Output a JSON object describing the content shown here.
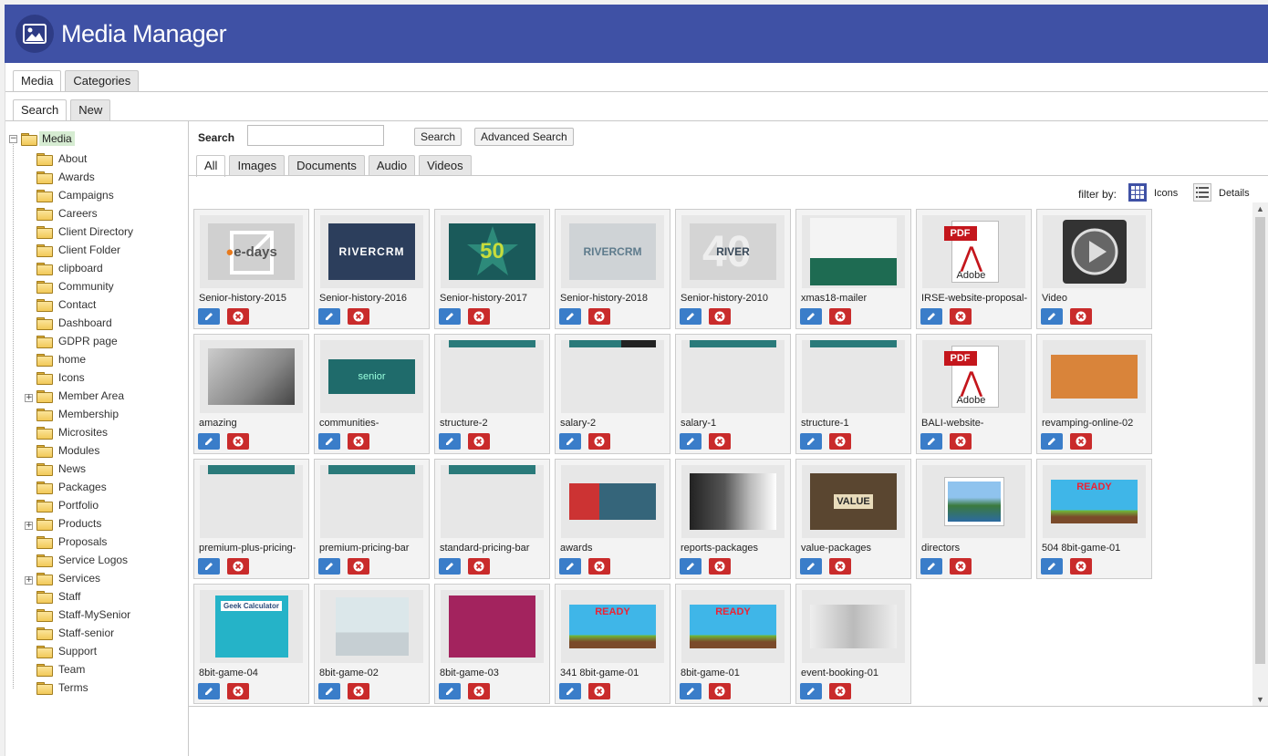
{
  "header": {
    "title": "Media Manager",
    "icon": "image-icon"
  },
  "top_tabs": [
    {
      "label": "Media",
      "active": true
    },
    {
      "label": "Categories",
      "active": false
    }
  ],
  "sub_tabs": [
    {
      "label": "Search",
      "active": true
    },
    {
      "label": "New",
      "active": false
    }
  ],
  "tree": {
    "root": "Media",
    "items": [
      {
        "label": "About"
      },
      {
        "label": "Awards"
      },
      {
        "label": "Campaigns"
      },
      {
        "label": "Careers"
      },
      {
        "label": "Client Directory"
      },
      {
        "label": "Client Folder"
      },
      {
        "label": "clipboard"
      },
      {
        "label": "Community"
      },
      {
        "label": "Contact"
      },
      {
        "label": "Dashboard"
      },
      {
        "label": "GDPR page"
      },
      {
        "label": "home"
      },
      {
        "label": "Icons"
      },
      {
        "label": "Member Area",
        "expandable": true
      },
      {
        "label": "Membership"
      },
      {
        "label": "Microsites"
      },
      {
        "label": "Modules"
      },
      {
        "label": "News"
      },
      {
        "label": "Packages"
      },
      {
        "label": "Portfolio"
      },
      {
        "label": "Products",
        "expandable": true
      },
      {
        "label": "Proposals"
      },
      {
        "label": "Service Logos"
      },
      {
        "label": "Services",
        "expandable": true
      },
      {
        "label": "Staff"
      },
      {
        "label": "Staff-MySenior"
      },
      {
        "label": "Staff-senior"
      },
      {
        "label": "Support"
      },
      {
        "label": "Team"
      },
      {
        "label": "Terms"
      }
    ]
  },
  "search": {
    "label": "Search",
    "value": "",
    "search_button": "Search",
    "advanced_button": "Advanced Search"
  },
  "filter_tabs": [
    {
      "label": "All",
      "active": true
    },
    {
      "label": "Images"
    },
    {
      "label": "Documents"
    },
    {
      "label": "Audio"
    },
    {
      "label": "Videos"
    }
  ],
  "filter": {
    "label": "filter by:",
    "icons_label": "Icons",
    "details_label": "Details"
  },
  "media": [
    {
      "name": "Senior-history-2015",
      "thumb": "edays"
    },
    {
      "name": "Senior-history-2016",
      "thumb": "rivercrm-dark"
    },
    {
      "name": "Senior-history-2017",
      "thumb": "star50"
    },
    {
      "name": "Senior-history-2018",
      "thumb": "rivercrm-light"
    },
    {
      "name": "Senior-history-2010",
      "thumb": "river40"
    },
    {
      "name": "xmas18-mailer",
      "thumb": "xmas"
    },
    {
      "name": "IRSE-website-proposal-",
      "thumb": "pdf"
    },
    {
      "name": "Video",
      "thumb": "video"
    },
    {
      "name": "amazing",
      "thumb": "birds"
    },
    {
      "name": "communities-",
      "thumb": "senior-teal"
    },
    {
      "name": "structure-2",
      "thumb": "strip"
    },
    {
      "name": "salary-2",
      "thumb": "strip-dark"
    },
    {
      "name": "salary-1",
      "thumb": "strip"
    },
    {
      "name": "structure-1",
      "thumb": "strip"
    },
    {
      "name": "BALI-website-",
      "thumb": "pdf"
    },
    {
      "name": "revamping-online-02",
      "thumb": "speech"
    },
    {
      "name": "premium-plus-pricing-",
      "thumb": "pricing"
    },
    {
      "name": "premium-pricing-bar",
      "thumb": "pricing"
    },
    {
      "name": "standard-pricing-bar",
      "thumb": "pricing"
    },
    {
      "name": "awards",
      "thumb": "awards"
    },
    {
      "name": "reports-packages",
      "thumb": "office"
    },
    {
      "name": "value-packages",
      "thumb": "value"
    },
    {
      "name": "directors",
      "thumb": "landscape"
    },
    {
      "name": "504 8bit-game-01",
      "thumb": "game"
    },
    {
      "name": "8bit-game-04",
      "thumb": "calc"
    },
    {
      "name": "8bit-game-02",
      "thumb": "street"
    },
    {
      "name": "8bit-game-03",
      "thumb": "purple"
    },
    {
      "name": "341 8bit-game-01",
      "thumb": "game"
    },
    {
      "name": "8bit-game-01",
      "thumb": "game"
    },
    {
      "name": "event-booking-01",
      "thumb": "meeting"
    }
  ],
  "thumb_texts": {
    "edays": "e-days",
    "river": "RIVER",
    "rivercrm": "RIVERCRM",
    "fifty": "50",
    "forty": "40",
    "pdf_word": "PDF",
    "adobe": "Adobe",
    "ready": "READY",
    "value_word": "VALUE",
    "senior_word": "senior",
    "calc_word": "Geek Calculator"
  },
  "colors": {
    "header": "#3f51a5",
    "edit": "#3a7dc9",
    "delete": "#c92b2b"
  }
}
